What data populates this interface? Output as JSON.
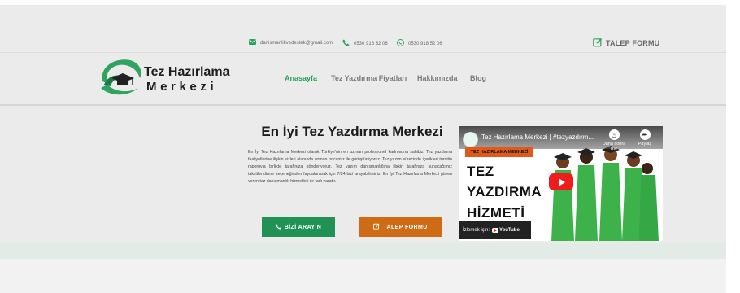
{
  "topbar": {
    "email": "danismanlikvedestek@gmail.com",
    "phone1": "0530 918 52 06",
    "phone2": "0530 918 52 06",
    "request_form": "TALEP FORMU"
  },
  "logo": {
    "line1": "Tez Hazırlama",
    "line2": "Merkezi"
  },
  "nav": {
    "items": [
      {
        "label": "Anasayfa",
        "active": true
      },
      {
        "label": "Tez Yazdırma Fiyatları",
        "active": false
      },
      {
        "label": "Hakkımızda",
        "active": false
      },
      {
        "label": "Blog",
        "active": false
      }
    ]
  },
  "hero": {
    "title": "En İyi Tez Yazdırma Merkezi",
    "paragraph": "En İyi Tez Hazırlama Merkezi olarak Türkiye'nin en uzman profesyonel kadrosuna sahibiz. Tez yazdırma faaliyetlerine ilişkin sizleri alanında uzman hocamız ile görüştürüyoruz. Tez yazım sürecinde içerikleri turnitin raporuyla birlikte tarafınıza gönderiyoruz. Tez yazım danışmanlığına ilişkin tarafınıza sunacağımız taksitlendirme seçeneğinden faydalanarak için 7/24 bizi arayabilirsiniz. En İyi Tez Hazırlama Merkezi güven veren tez danışmanlık hizmetleri ile fark yaratır.",
    "call_button": "BİZİ ARAYIN",
    "form_button": "TALEP FORMU"
  },
  "video": {
    "title": "Tez Hazırlama Merkezi | #tezyazdırm...",
    "watch_later": "Daha sonra izle",
    "share": "Paylaş",
    "badge": "TEZ HAZIRLAMA MERKEZİ",
    "big_line1": "TEZ",
    "big_line2": "YAZDIRMA",
    "big_line3": "HİZMETİ",
    "watch_on": "İzlemek için:",
    "youtube": "YouTube"
  },
  "colors": {
    "brand_green": "#26a35a",
    "button_green": "#1f9254",
    "button_orange": "#cf6a15",
    "graduate_green": "#3eb24a"
  }
}
